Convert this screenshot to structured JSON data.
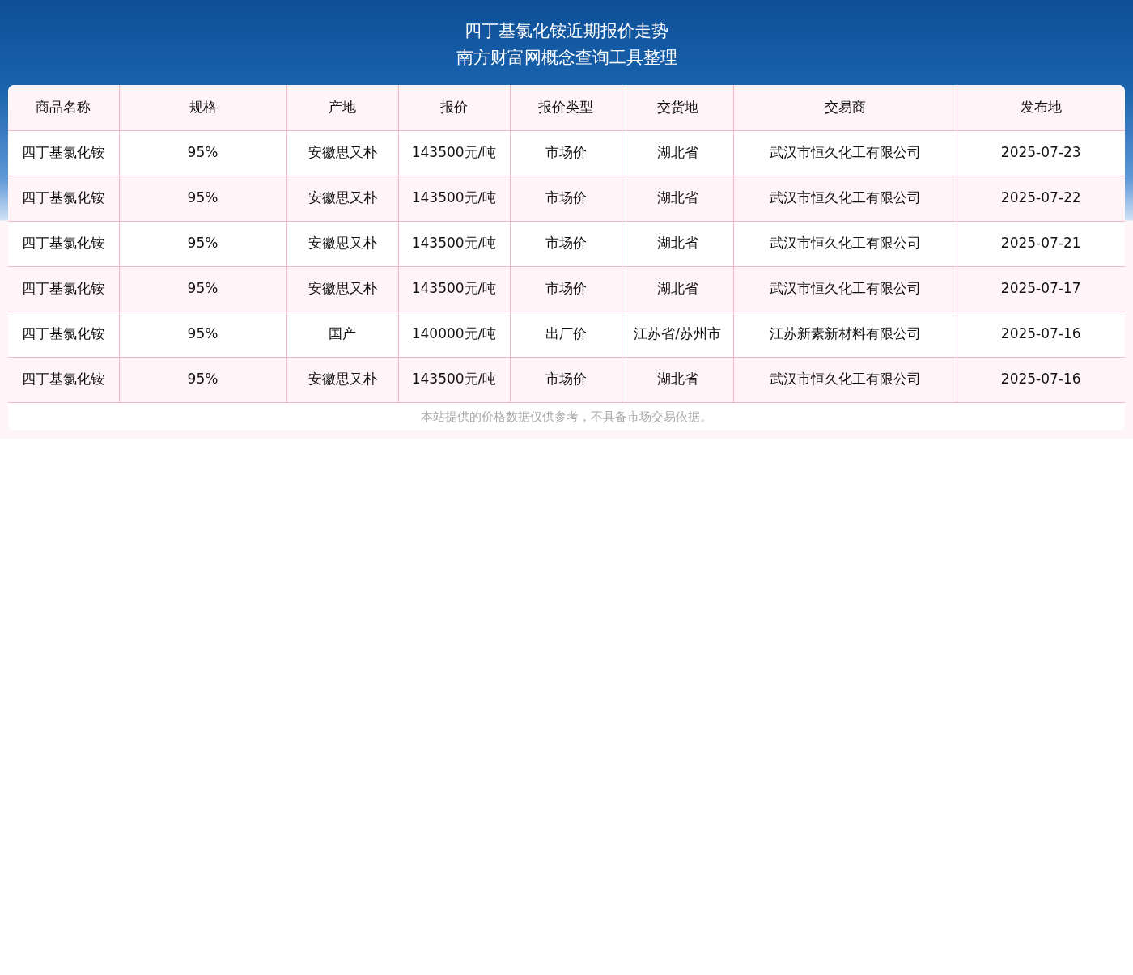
{
  "header": {
    "title": "四丁基氯化铵近期报价走势",
    "subtitle": "南方财富网概念查询工具整理"
  },
  "table": {
    "columns": [
      "商品名称",
      "规格",
      "产地",
      "报价",
      "报价类型",
      "交货地",
      "交易商",
      "发布地"
    ],
    "rows": [
      [
        "四丁基氯化铵",
        "95%",
        "安徽思又朴",
        "143500元/吨",
        "市场价",
        "湖北省",
        "武汉市恒久化工有限公司",
        "2025-07-23"
      ],
      [
        "四丁基氯化铵",
        "95%",
        "安徽思又朴",
        "143500元/吨",
        "市场价",
        "湖北省",
        "武汉市恒久化工有限公司",
        "2025-07-22"
      ],
      [
        "四丁基氯化铵",
        "95%",
        "安徽思又朴",
        "143500元/吨",
        "市场价",
        "湖北省",
        "武汉市恒久化工有限公司",
        "2025-07-21"
      ],
      [
        "四丁基氯化铵",
        "95%",
        "安徽思又朴",
        "143500元/吨",
        "市场价",
        "湖北省",
        "武汉市恒久化工有限公司",
        "2025-07-17"
      ],
      [
        "四丁基氯化铵",
        "95%",
        "国产",
        "140000元/吨",
        "出厂价",
        "江苏省/苏州市",
        "江苏新素新材料有限公司",
        "2025-07-16"
      ],
      [
        "四丁基氯化铵",
        "95%",
        "安徽思又朴",
        "143500元/吨",
        "市场价",
        "湖北省",
        "武汉市恒久化工有限公司",
        "2025-07-16"
      ]
    ]
  },
  "note": "本站提供的价格数据仅供参考，不具备市场交易依据。"
}
